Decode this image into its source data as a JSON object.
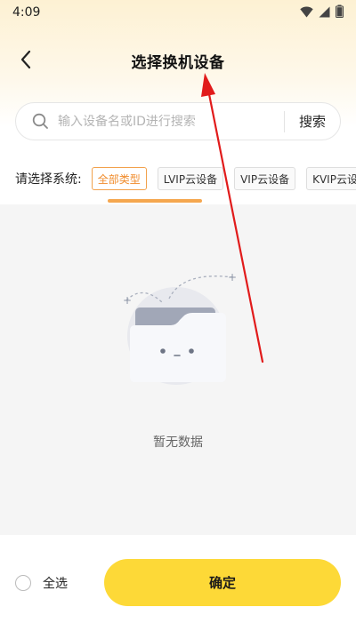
{
  "status_bar": {
    "time": "4:09",
    "icons": [
      "wifi-icon",
      "signal-icon",
      "battery-icon"
    ]
  },
  "header": {
    "title": "选择换机设备",
    "back_icon": "chevron-left-icon"
  },
  "search": {
    "placeholder": "输入设备名或ID进行搜索",
    "value": "",
    "button_label": "搜索"
  },
  "filter": {
    "label": "请选择系统:",
    "chips": [
      {
        "label": "全部类型",
        "active": true
      },
      {
        "label": "LVIP云设备",
        "active": false
      },
      {
        "label": "VIP云设备",
        "active": false
      },
      {
        "label": "KVIP云设",
        "active": false
      }
    ]
  },
  "empty_state": {
    "text": "暂无数据",
    "icon": "empty-folder-icon"
  },
  "footer": {
    "select_all_label": "全选",
    "select_all_checked": false,
    "confirm_label": "确定"
  },
  "colors": {
    "accent_orange": "#f08c2c",
    "confirm_yellow": "#fdd937",
    "annotation_red": "#e11b1b"
  }
}
